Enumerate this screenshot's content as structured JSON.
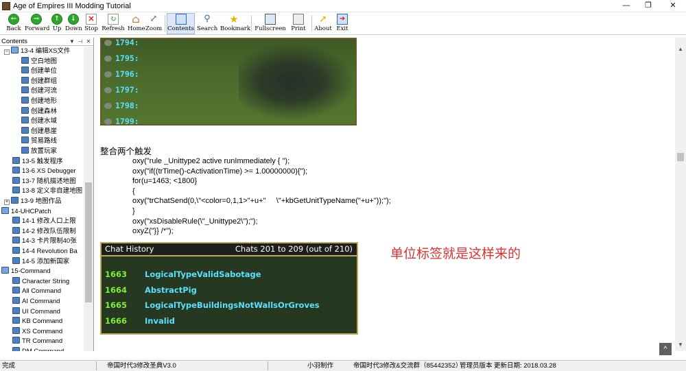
{
  "window": {
    "title": "Age of Empires III Modding Tutorial",
    "minimize": "—",
    "maximize": "❐",
    "close": "✕"
  },
  "toolbar": {
    "back": "Back",
    "forward": "Forward",
    "up": "Up",
    "down": "Down",
    "stop": "Stop",
    "refresh": "Refresh",
    "home": "Home",
    "zoom": "Zoom",
    "contents": "Contents",
    "search": "Search",
    "bookmark": "Bookmark",
    "fullscreen": "Fullscreen",
    "print": "Print",
    "about": "About",
    "exit": "Exit"
  },
  "left_pane": {
    "title": "Contents",
    "tree": [
      "13-4 编辑XS文件",
      "空白地图",
      "创建单位",
      "创建群组",
      "创建河流",
      "创建地形",
      "创建森林",
      "创建水域",
      "创建悬崖",
      "贸易路线",
      "放置玩家",
      "13-5 触发程序",
      "13-6 XS Debugger",
      "13-7 随机描述地图",
      "13-8 定义非自建地图",
      "13-9 地图作品",
      "14-UHCPatch",
      "14-1 修改人口上限",
      "14-2 修改队伍限制",
      "14-3 卡片限制40张",
      "14-4 Revolution Ba",
      "14-5 添加新国家",
      "15-Command",
      "Character String",
      "All Command",
      "AI Command",
      "UI Command",
      "KB Command",
      "XS Command",
      "TR Command",
      "DM Command"
    ]
  },
  "content": {
    "log_lines": [
      "1794:",
      "1795:",
      "1796:",
      "1797:",
      "1798:",
      "1799:"
    ],
    "heading": "整合两个触发",
    "code_lines": [
      "oxy(\"rule _Unittype2 active runImmediately { \");",
      "oxy(\"if((trTime()-cActivationTime) >= 1.00000000){\");",
      "for(u=1463; <1800}",
      "{",
      "oxy(\"trChatSend(0,\\\"<color=0,1,1>\"+u+\"     \\\"+kbGetUnitTypeName(\"+u+\"));\");",
      "}",
      "oxy(\"xsDisableRule(\\\"_Unittype2\\\");\");",
      "oxyZ(\"}} /*\");"
    ],
    "chat_history": {
      "title": "Chat History",
      "count": "Chats 201 to 209 (out of 210)",
      "rows": [
        {
          "num": "1663",
          "text": "LogicalTypeValidSabotage"
        },
        {
          "num": "1664",
          "text": "AbstractPig"
        },
        {
          "num": "1665",
          "text": "LogicalTypeBuildingsNotWallsOrGroves"
        },
        {
          "num": "1666",
          "text": "Invalid"
        }
      ]
    },
    "note": "单位标签就是这样来的",
    "scroll_top_icon": "^"
  },
  "statusbar": {
    "status": "完成",
    "book_title": "帝国时代3修改圣典V3.0",
    "author": "小羽制作",
    "group": "帝国时代3修改&交流群（85442352）",
    "version": "管理员版本",
    "date": "更新日期: 2018.03.28"
  },
  "colors": {
    "accent": "#2fa52b",
    "log_text": "#59e1ff",
    "chat_num": "#7cf03c",
    "note": "#e03030"
  }
}
